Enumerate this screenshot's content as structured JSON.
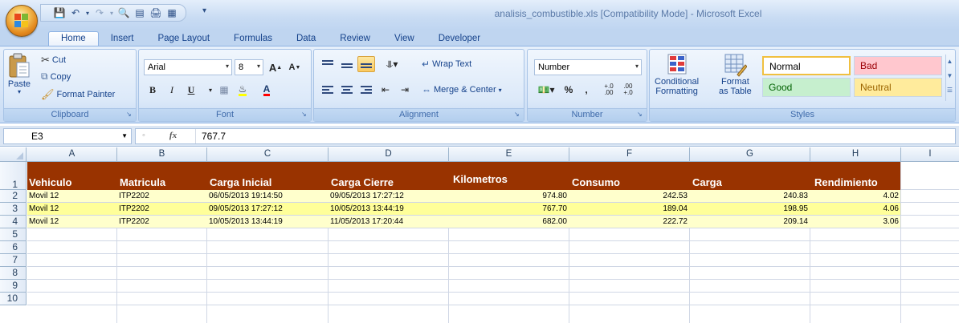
{
  "app": {
    "title": "analisis_combustible.xls  [Compatibility Mode]  -  Microsoft Excel"
  },
  "quick_access": [
    "save-icon",
    "undo-icon",
    "redo-icon",
    "print-preview-icon",
    "form-icon",
    "print-icon",
    "view-icon"
  ],
  "tabs": [
    {
      "label": "Home",
      "active": true
    },
    {
      "label": "Insert"
    },
    {
      "label": "Page Layout"
    },
    {
      "label": "Formulas"
    },
    {
      "label": "Data"
    },
    {
      "label": "Review"
    },
    {
      "label": "View"
    },
    {
      "label": "Developer"
    }
  ],
  "ribbon": {
    "clipboard": {
      "label": "Clipboard",
      "paste": "Paste",
      "cut": "Cut",
      "copy": "Copy",
      "format_painter": "Format Painter"
    },
    "font": {
      "label": "Font",
      "name": "Arial",
      "size": "8",
      "bold": "B",
      "italic": "I",
      "underline": "U"
    },
    "alignment": {
      "label": "Alignment",
      "wrap_text": "Wrap Text",
      "merge_center": "Merge & Center"
    },
    "number": {
      "label": "Number",
      "format": "Number",
      "percent": "%",
      "comma": ","
    },
    "styles": {
      "label": "Styles",
      "conditional_1": "Conditional",
      "conditional_2": "Formatting",
      "format_table_1": "Format",
      "format_table_2": "as Table",
      "normal": "Normal",
      "bad": "Bad",
      "good": "Good",
      "neutral": "Neutral"
    }
  },
  "formula_bar": {
    "name_box": "E3",
    "fx": "fx",
    "value": "767.7"
  },
  "columns": [
    "A",
    "B",
    "C",
    "D",
    "E",
    "F",
    "G",
    "H",
    "I"
  ],
  "rows": [
    "1",
    "2",
    "3",
    "4",
    "5",
    "6",
    "7",
    "8",
    "9",
    "10"
  ],
  "sheet": {
    "headers": {
      "vehiculo": "Vehiculo",
      "matricula": "Matricula",
      "carga_inicial": "Carga Inicial",
      "carga_cierre": "Carga Cierre",
      "kilometros": "Kilometros",
      "consumo": "Consumo",
      "carga": "Carga",
      "rendimiento": "Rendimiento"
    },
    "data": [
      {
        "vehiculo": "Movil 12",
        "matricula": "ITP2202",
        "carga_inicial": "06/05/2013 19:14:50",
        "carga_cierre": "09/05/2013 17:27:12",
        "kilometros": "974.80",
        "consumo": "242.53",
        "carga": "240.83",
        "rendimiento": "4.02"
      },
      {
        "vehiculo": "Movil 12",
        "matricula": "ITP2202",
        "carga_inicial": "09/05/2013 17:27:12",
        "carga_cierre": "10/05/2013 13:44:19",
        "kilometros": "767.70",
        "consumo": "189.04",
        "carga": "198.95",
        "rendimiento": "4.06"
      },
      {
        "vehiculo": "Movil 12",
        "matricula": "ITP2202",
        "carga_inicial": "10/05/2013 13:44:19",
        "carga_cierre": "11/05/2013 17:20:44",
        "kilometros": "682.00",
        "consumo": "222.72",
        "carga": "209.14",
        "rendimiento": "3.06"
      }
    ]
  },
  "colors": {
    "header_fill": "#993300",
    "band_light": "#ffffcc",
    "band_dark": "#ffff99"
  }
}
